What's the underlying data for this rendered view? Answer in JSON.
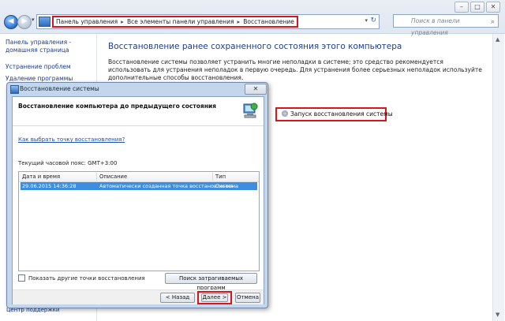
{
  "window": {
    "controls": {
      "minimize": "–",
      "maximize": "□",
      "close": "✕"
    },
    "breadcrumbs": [
      "Панель управления",
      "Все элементы панели управления",
      "Восстановление"
    ],
    "search_placeholder": "Поиск в панели управления"
  },
  "leftnav": {
    "items": [
      "Панель управления -",
      "домашняя страница",
      "Устранение проблем",
      "Удаление программы"
    ],
    "bottom_peek": "Центр поддержки"
  },
  "main": {
    "title": "Восстановление ранее сохраненного состояния этого компьютера",
    "description": "Восстановление системы позволяет устранить многие неполадки в системе; это средство рекомендуется использовать для устранения неполадок в первую очередь. Для устранения более серьезных неполадок используйте дополнительные способы восстановления.",
    "run_restore_button": "Запуск восстановления системы"
  },
  "dialog": {
    "title": "Восстановление системы",
    "close": "✕",
    "heading": "Восстановление компьютера до предыдущего состояния",
    "link": "Как выбрать точку восстановления?",
    "timezone": "Текущий часовой пояс: GMT+3:00",
    "table": {
      "columns": [
        "Дата и время",
        "Описание",
        "Тип"
      ],
      "rows": [
        {
          "date": "29.06.2015 14:36:28",
          "description": "Автоматически созданная точка восстановления",
          "type": "Система",
          "selected": true
        }
      ]
    },
    "show_more_checkbox": "Показать другие точки восстановления",
    "scan_button": "Поиск затрагиваемых программ",
    "back_button": "< Назад",
    "next_button": "Далее >",
    "cancel_button": "Отмена"
  },
  "colors": {
    "highlight_red": "#d9141b",
    "title_blue": "#1e3f8a",
    "selection": "#3d8ee0"
  }
}
